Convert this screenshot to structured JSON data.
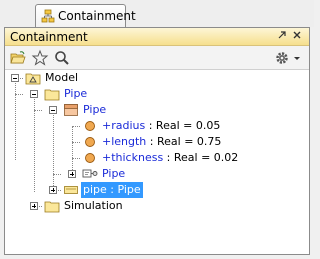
{
  "tab": {
    "label": "Containment"
  },
  "panel": {
    "title": "Containment"
  },
  "toolbar": {
    "icons": [
      "open-folder-icon",
      "star-icon",
      "search-icon",
      "gear-icon"
    ]
  },
  "tree": {
    "model": "Model",
    "pipe_package": "Pipe",
    "pipe_block": "Pipe",
    "radius": {
      "name": "+radius",
      "rest": " : Real = 0.05"
    },
    "length": {
      "name": "+length",
      "rest": " : Real = 0.75"
    },
    "thickness": {
      "name": "+thickness",
      "rest": " : Real = 0.02"
    },
    "pipe_diagram": "Pipe",
    "pipe_instance": "pipe : Pipe",
    "simulation": "Simulation"
  },
  "colors": {
    "title_bar": "#f6df8d",
    "selection": "#3399ff",
    "link_blue": "#1b2bd8"
  }
}
